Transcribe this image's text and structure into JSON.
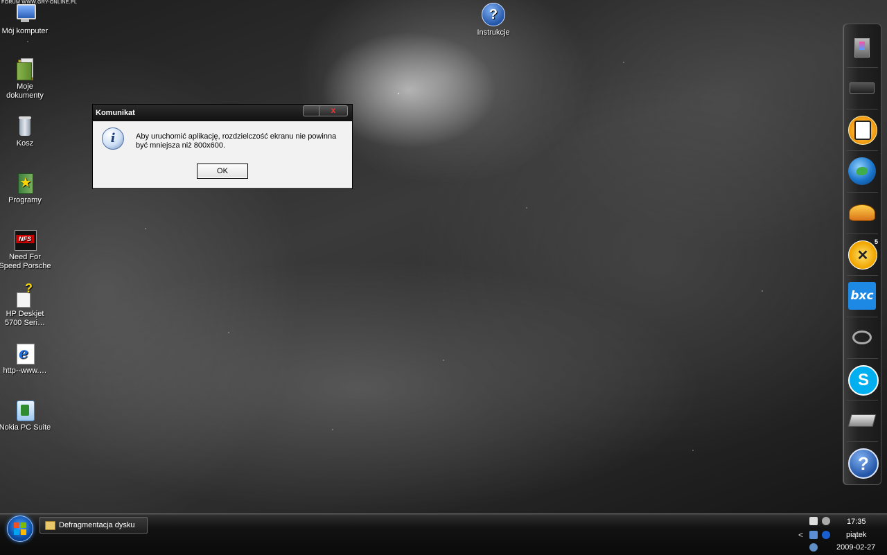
{
  "watermark": "FORUM WWW.GRY-ONLINE.PL",
  "desktop": {
    "icons": [
      {
        "label": "Mój komputer",
        "icon": "my-computer-icon"
      },
      {
        "label": "Moje dokumenty",
        "icon": "my-documents-icon"
      },
      {
        "label": "Kosz",
        "icon": "recycle-bin-icon"
      },
      {
        "label": "Programy",
        "icon": "programs-icon"
      },
      {
        "label": "Need For Speed Porsche",
        "icon": "nfs-icon"
      },
      {
        "label": "HP Deskjet 5700 Seri…",
        "icon": "printer-help-icon"
      },
      {
        "label": "http--www.…",
        "icon": "internet-explorer-icon"
      },
      {
        "label": "Nokia PC Suite",
        "icon": "nokia-pc-suite-icon"
      }
    ],
    "instrukcje": {
      "label": "Instrukcje",
      "glyph": "?"
    }
  },
  "dialog": {
    "title": "Komunikat",
    "close_glyph": "x",
    "info_glyph": "i",
    "message": "Aby uruchomić aplikację, rozdzielczość ekranu nie powinna być mniejsza niż 800x600.",
    "ok_label": "OK"
  },
  "dock": {
    "items": [
      {
        "name": "camera-icon"
      },
      {
        "name": "battery-icon"
      },
      {
        "name": "face-app-icon"
      },
      {
        "name": "globe-icon"
      },
      {
        "name": "stadium-icon"
      },
      {
        "name": "stopwatch-icon",
        "badge": "5"
      },
      {
        "name": "bxc-icon",
        "label": "bxc"
      },
      {
        "name": "glasses-icon"
      },
      {
        "name": "skype-icon",
        "label": "S"
      },
      {
        "name": "scanner-icon"
      },
      {
        "name": "help-icon",
        "label": "?"
      }
    ]
  },
  "taskbar": {
    "task_label": "Defragmentacja dysku",
    "tray_arrow": "<",
    "time": "17:35",
    "day": "piątek",
    "date": "2009-02-27"
  },
  "colors": {
    "windows_blue": "#0d4ea8",
    "close_red": "#ff3030",
    "skype_blue": "#00aff0",
    "bxc_blue": "#1e88e5"
  }
}
